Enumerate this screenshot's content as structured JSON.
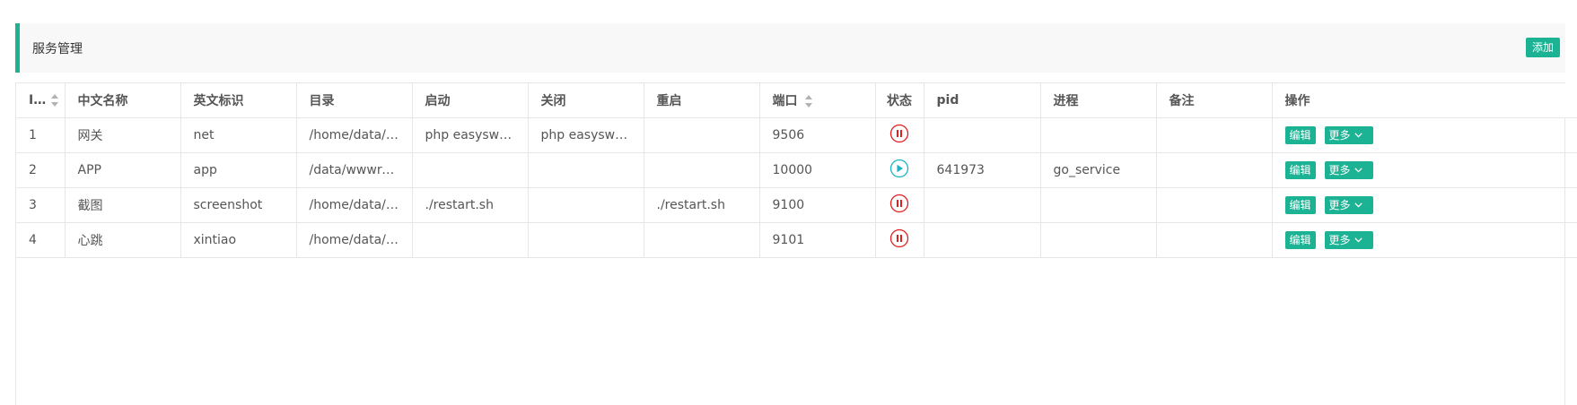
{
  "header": {
    "title": "服务管理",
    "add_label": "添加"
  },
  "colors": {
    "accent": "#1bb394",
    "stopped": "#e02020",
    "running": "#1bb3c4"
  },
  "table": {
    "columns": [
      "ID",
      "中文名称",
      "英文标识",
      "目录",
      "启动",
      "关闭",
      "重启",
      "端口",
      "状态",
      "pid",
      "进程",
      "备注",
      "操作"
    ],
    "sortable_columns": [
      "ID",
      "端口"
    ],
    "rows": [
      {
        "id": "1",
        "cn_name": "网关",
        "en_name": "net",
        "dir": "/home/data/zhw…",
        "start": "php easyswool…",
        "stop": "php easyswool…",
        "restart": "",
        "port": "9506",
        "status": "stopped",
        "status_icon": "pause-icon",
        "pid": "",
        "process": "",
        "remark": "",
        "edit_label": "编辑",
        "more_label": "更多"
      },
      {
        "id": "2",
        "cn_name": "APP",
        "en_name": "app",
        "dir": "/data/wwwroot/…",
        "start": "",
        "stop": "",
        "restart": "",
        "port": "10000",
        "status": "running",
        "status_icon": "play-icon",
        "pid": "641973",
        "process": "go_service",
        "remark": "",
        "edit_label": "编辑",
        "more_label": "更多"
      },
      {
        "id": "3",
        "cn_name": "截图",
        "en_name": "screenshot",
        "dir": "/home/data/zhw…",
        "start": "./restart.sh",
        "stop": "",
        "restart": "./restart.sh",
        "port": "9100",
        "status": "stopped",
        "status_icon": "pause-icon",
        "pid": "",
        "process": "",
        "remark": "",
        "edit_label": "编辑",
        "more_label": "更多"
      },
      {
        "id": "4",
        "cn_name": "心跳",
        "en_name": "xintiao",
        "dir": "/home/data/zhw…",
        "start": "",
        "stop": "",
        "restart": "",
        "port": "9101",
        "status": "stopped",
        "status_icon": "pause-icon",
        "pid": "",
        "process": "",
        "remark": "",
        "edit_label": "编辑",
        "more_label": "更多"
      }
    ]
  }
}
